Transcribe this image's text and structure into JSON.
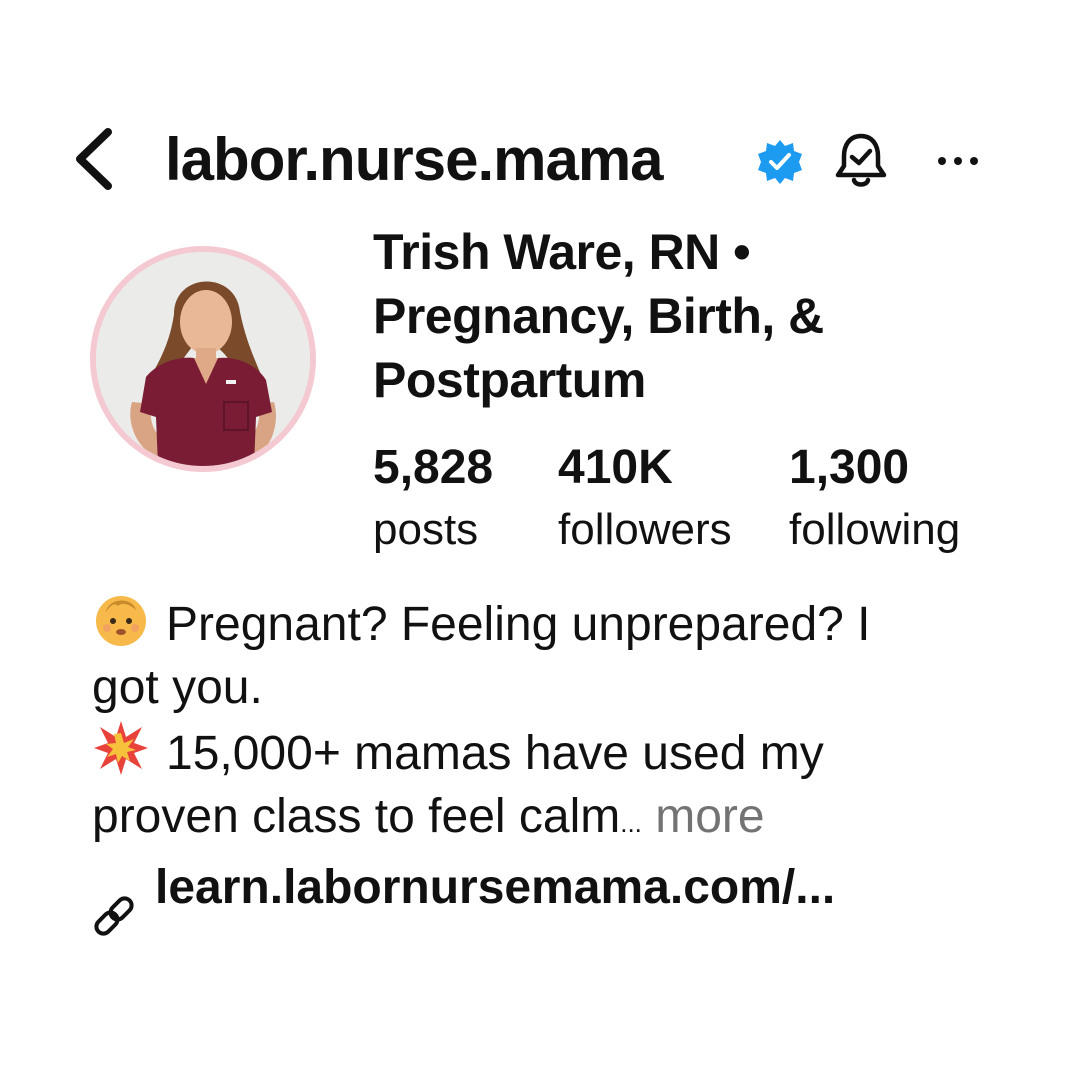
{
  "header": {
    "username": "labor.nurse.mama",
    "verified": true,
    "icons": {
      "back": "chevron-left-icon",
      "verified": "verified-badge-icon",
      "notifications": "bell-icon",
      "more": "more-horizontal-icon"
    }
  },
  "profile": {
    "display_name": "Trish Ware, RN • Pregnancy, Birth, & Postpartum",
    "avatar_ring_color": "#f4c9d2"
  },
  "stats": [
    {
      "value": "5,828",
      "label": "posts"
    },
    {
      "value": "410K",
      "label": "followers"
    },
    {
      "value": "1,300",
      "label": "following"
    }
  ],
  "bio": {
    "line1": "Pregnant? Feeling unprepared? I",
    "line2": "got you.",
    "line3": "15,000+ mamas have used my",
    "line4": "proven class to feel calm",
    "ellipsis": "...",
    "more_label": "more",
    "emoji1": "baby-emoji",
    "emoji2": "collision-emoji"
  },
  "link": {
    "text": "learn.labornursemama.com/...",
    "icon": "link-icon"
  },
  "colors": {
    "verified_blue": "#1d9bf0",
    "muted_text": "#737373",
    "text": "#111111"
  }
}
